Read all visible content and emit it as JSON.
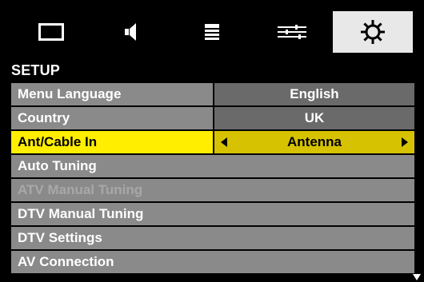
{
  "tabs": [
    {
      "icon": "picture-icon",
      "active": false
    },
    {
      "icon": "sound-icon",
      "active": false
    },
    {
      "icon": "channel-list-icon",
      "active": false
    },
    {
      "icon": "adjustments-icon",
      "active": false
    },
    {
      "icon": "setup-gear-icon",
      "active": true
    }
  ],
  "section": {
    "title": "SETUP"
  },
  "menu": {
    "items": [
      {
        "label": "Menu Language",
        "value": "English"
      },
      {
        "label": "Country",
        "value": "UK"
      },
      {
        "label": "Ant/Cable In",
        "value": "Antenna",
        "selected": true
      },
      {
        "label": "Auto Tuning"
      },
      {
        "label": "ATV Manual Tuning",
        "disabled": true
      },
      {
        "label": "DTV Manual Tuning"
      },
      {
        "label": "DTV Settings"
      },
      {
        "label": "AV Connection"
      }
    ]
  },
  "colors": {
    "selected_label_bg": "#ffee00",
    "selected_value_bg": "#d6c200",
    "row_bg": "#8a8a8a",
    "value_bg": "#6a6a6a",
    "active_tab_bg": "#e8e8e8"
  }
}
